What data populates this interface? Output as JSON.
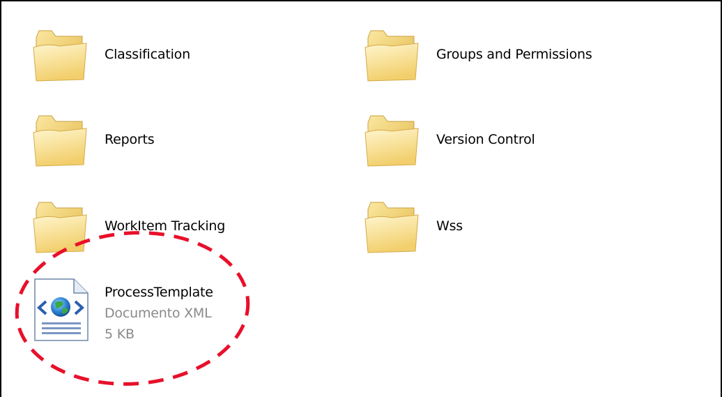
{
  "folders": [
    {
      "label": "Classification",
      "icon": "folder-icon"
    },
    {
      "label": "Groups and Permissions",
      "icon": "folder-icon"
    },
    {
      "label": "Reports",
      "icon": "folder-icon"
    },
    {
      "label": "Version Control",
      "icon": "folder-icon"
    },
    {
      "label": "WorkItem Tracking",
      "icon": "folder-icon"
    },
    {
      "label": "Wss",
      "icon": "folder-icon"
    }
  ],
  "file": {
    "label": "ProcessTemplate",
    "type": "Documento XML",
    "size": "5 KB",
    "icon": "xml-document-icon"
  },
  "colors": {
    "folder_light": "#fcecae",
    "folder_dark": "#e8c060",
    "highlight": "#e8102a"
  }
}
